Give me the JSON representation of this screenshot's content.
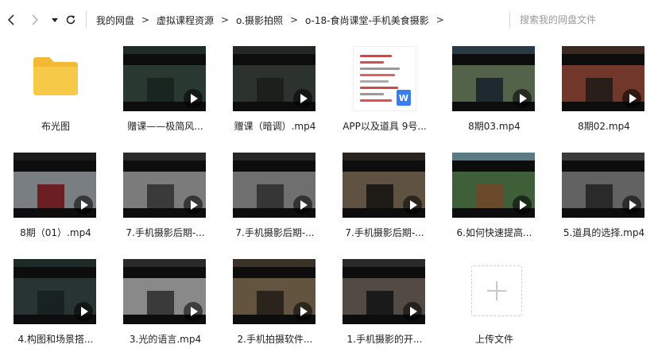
{
  "nav": {
    "back_icon": "chevron-left-icon",
    "forward_icon": "chevron-right-icon",
    "history_icon": "caret-down-icon",
    "refresh_icon": "refresh-icon"
  },
  "breadcrumb": [
    "我的网盘",
    "虚拟课程资源",
    "o.摄影拍照",
    "o-18-食尚课堂-手机美食摄影"
  ],
  "breadcrumb_separator": ">",
  "search": {
    "placeholder": "搜索我的网盘文件"
  },
  "files": [
    {
      "name": "布光图",
      "kind": "folder"
    },
    {
      "name": "赠课——极简风...",
      "kind": "video",
      "thumb_colors": [
        "#1f2b26",
        "#2d3b35",
        "#1a2420"
      ]
    },
    {
      "name": "赠课（暗调）.mp4",
      "kind": "video",
      "thumb_colors": [
        "#232824",
        "#2e3430",
        "#1c201d"
      ]
    },
    {
      "name": "APP以及道具 9号...",
      "kind": "doc",
      "badge": "W"
    },
    {
      "name": "8期03.mp4",
      "kind": "video",
      "thumb_colors": [
        "#2a3a44",
        "#5b6b4a",
        "#1e2a30"
      ]
    },
    {
      "name": "8期02.mp4",
      "kind": "video",
      "thumb_colors": [
        "#3a2a22",
        "#7a3a2c",
        "#2a1e1a"
      ]
    },
    {
      "name": "8期（01）.mp4",
      "kind": "video",
      "thumb_colors": [
        "#1c1c1c",
        "#8a8f94",
        "#6b1f22"
      ]
    },
    {
      "name": "7.手机摄影后期-...",
      "kind": "video",
      "thumb_colors": [
        "#2a2a2a",
        "#8a8a8a",
        "#3a3a3a"
      ]
    },
    {
      "name": "7.手机摄影后期-...",
      "kind": "video",
      "thumb_colors": [
        "#262626",
        "#7d7d7d",
        "#363636"
      ]
    },
    {
      "name": "7.手机摄影后期-...",
      "kind": "video",
      "thumb_colors": [
        "#2a2420",
        "#6a5a4a",
        "#1e1a16"
      ]
    },
    {
      "name": "6.如何快速提高...",
      "kind": "video",
      "thumb_colors": [
        "#5a7a86",
        "#3a5a2a",
        "#6a4a2a"
      ]
    },
    {
      "name": "5.道具的选择.mp4",
      "kind": "video",
      "thumb_colors": [
        "#3a3a3a",
        "#6a6a6a",
        "#2a2a2a"
      ]
    },
    {
      "name": "4.构图和场景搭...",
      "kind": "video",
      "thumb_colors": [
        "#1e2a28",
        "#2a3634",
        "#182220"
      ]
    },
    {
      "name": "3.光的语言.mp4",
      "kind": "video",
      "thumb_colors": [
        "#2a2a2a",
        "#9a9a9a",
        "#3a3a3a"
      ]
    },
    {
      "name": "2.手机拍摄软件...",
      "kind": "video",
      "thumb_colors": [
        "#3a3226",
        "#6a5a44",
        "#2a241c"
      ]
    },
    {
      "name": "1.手机摄影的开...",
      "kind": "video",
      "thumb_colors": [
        "#2a2a2a",
        "#5a5048",
        "#1a1a1a"
      ]
    },
    {
      "name": "上传文件",
      "kind": "upload"
    }
  ],
  "colors": {
    "folder": "#f7c948",
    "folder_tab": "#f3b935",
    "accent": "#3a7df0"
  }
}
